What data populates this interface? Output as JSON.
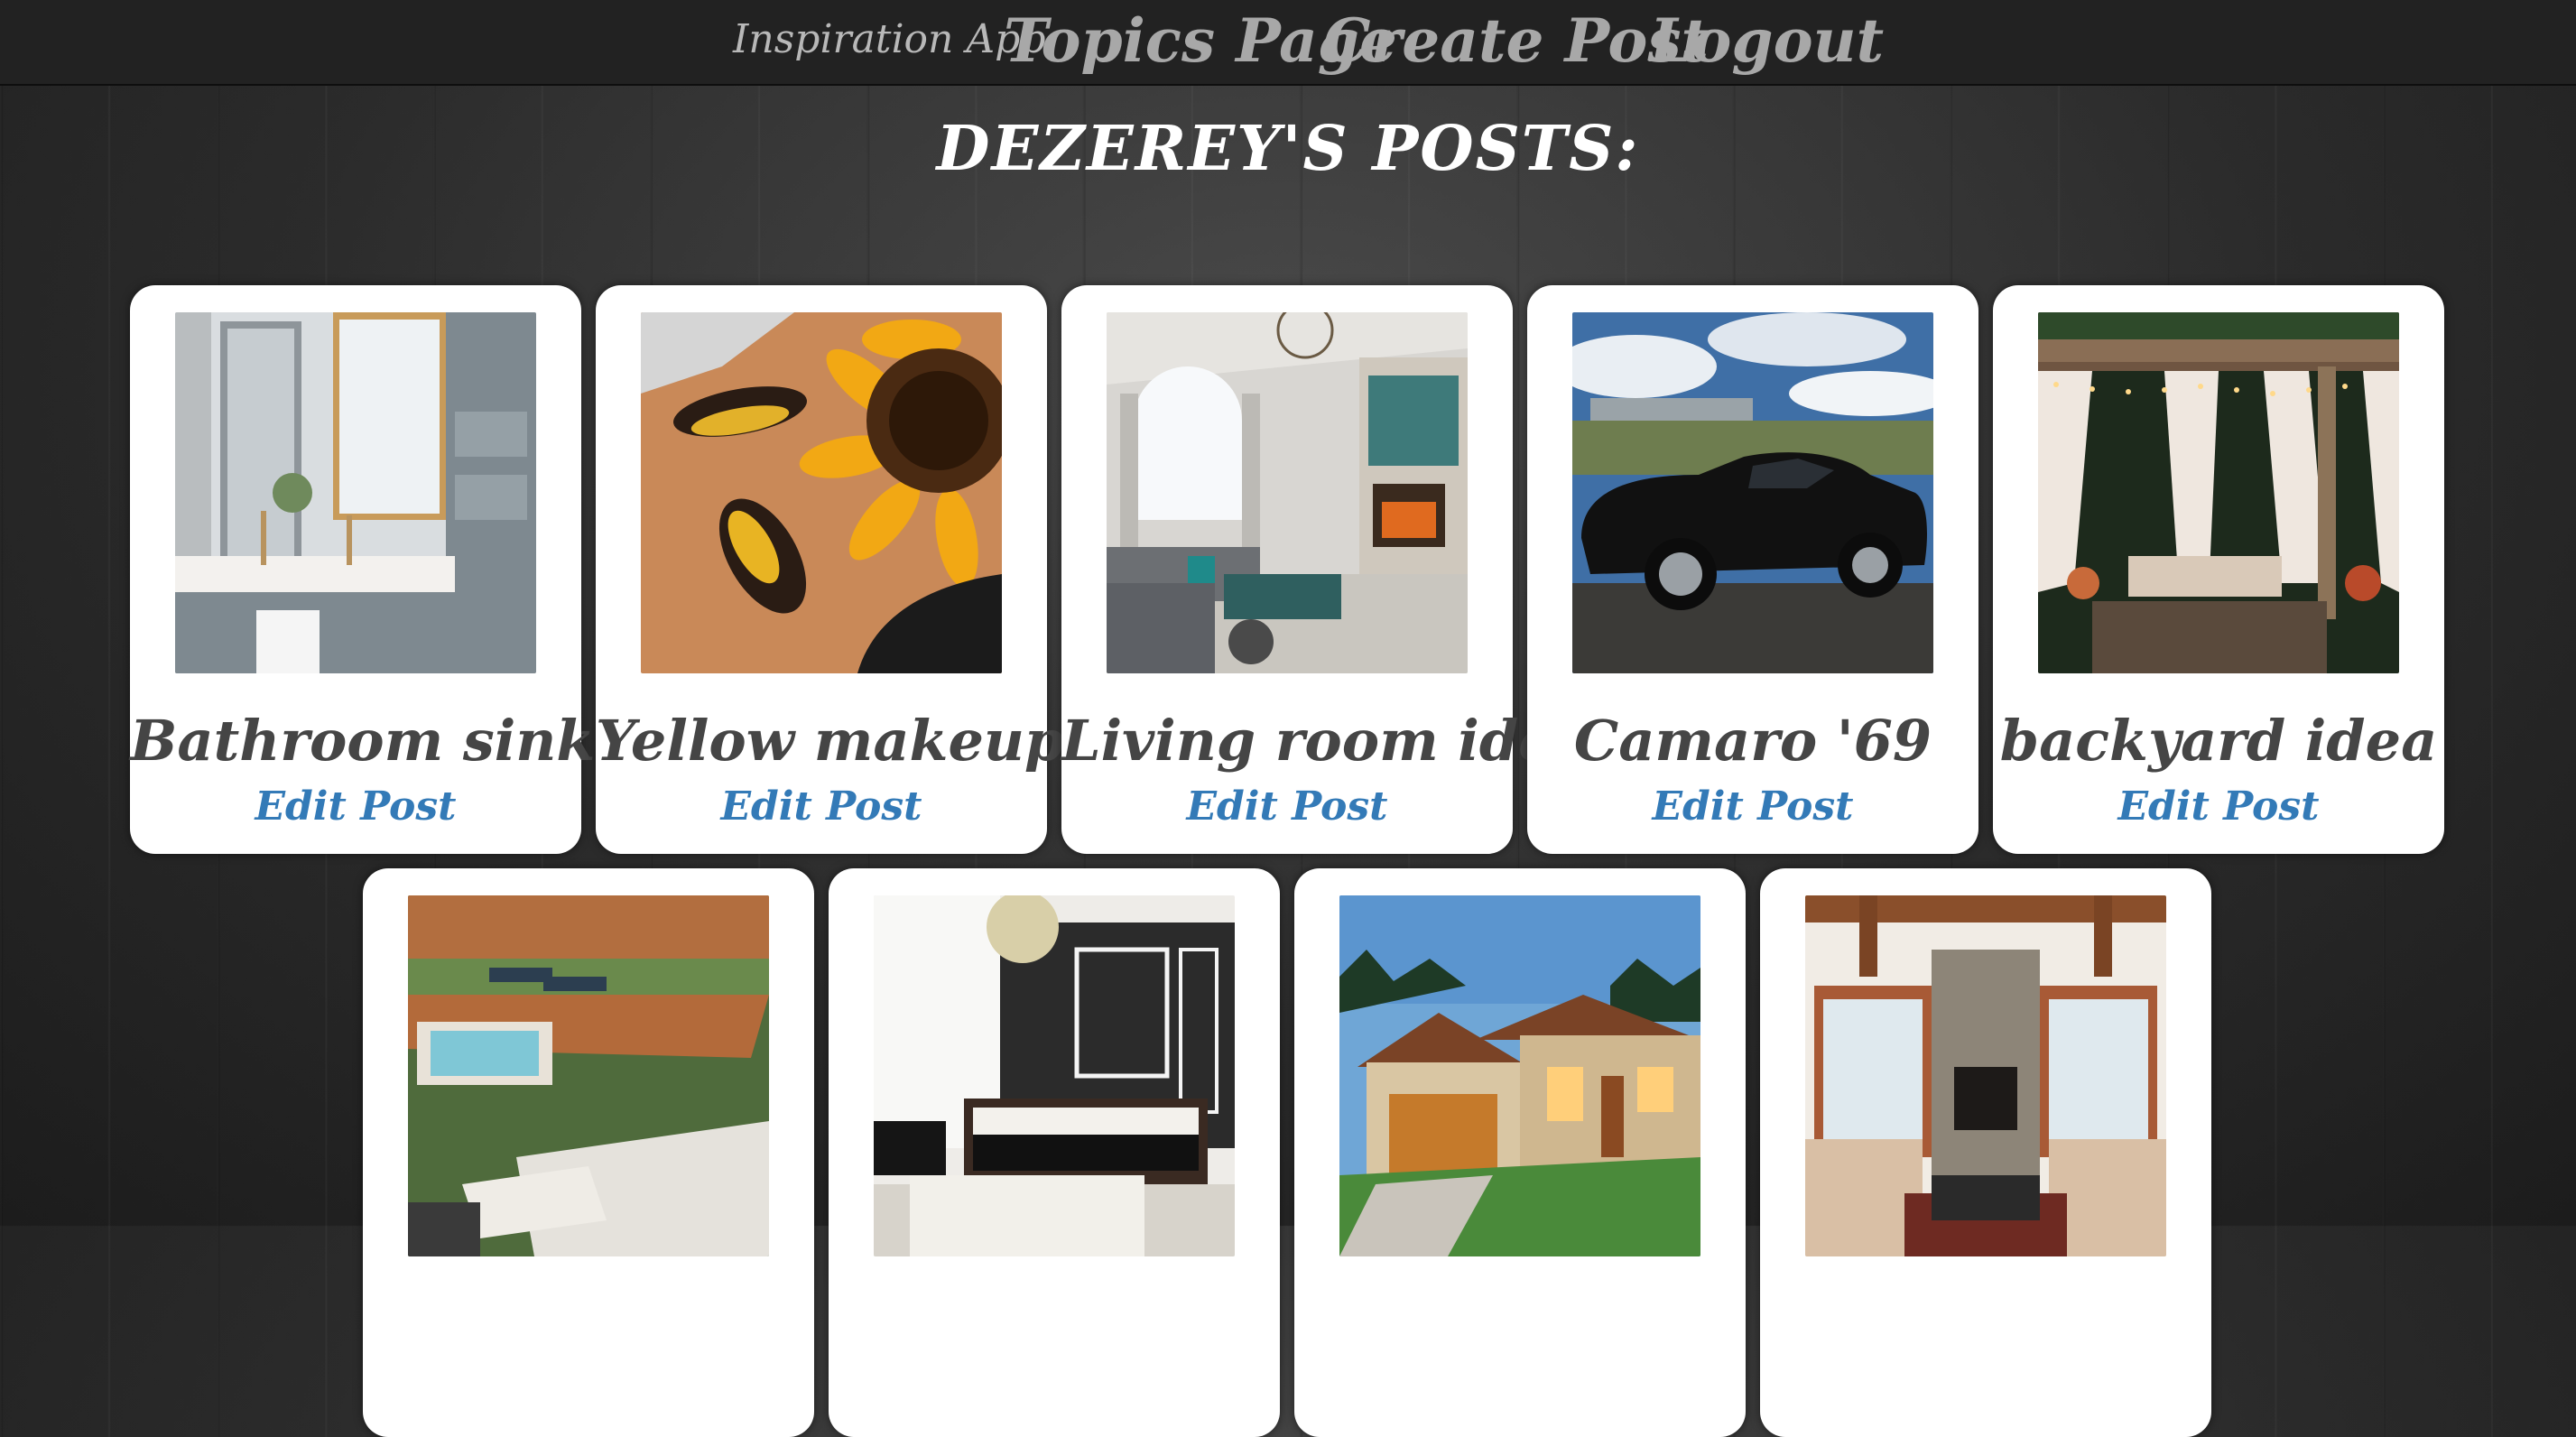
{
  "navbar": {
    "brand": "Inspiration App",
    "links": [
      "Topics Page",
      "Create Post",
      "Logout"
    ]
  },
  "heading": "DEZEREY'S POSTS:",
  "posts": [
    {
      "title": "Bathroom sink",
      "edit": "Edit Post",
      "image": "bathroom-sink-photo"
    },
    {
      "title": "Yellow makeup",
      "edit": "Edit Post",
      "image": "yellow-makeup-sunflower-photo"
    },
    {
      "title": "Living room idea",
      "edit": "Edit Post",
      "image": "living-room-fireplace-photo"
    },
    {
      "title": "Camaro '69",
      "edit": "Edit Post",
      "image": "black-camaro-car-photo"
    },
    {
      "title": "backyard idea",
      "edit": "Edit Post",
      "image": "backyard-pergola-photo"
    },
    {
      "title": "",
      "edit": "",
      "image": "patio-hot-tub-deck-photo"
    },
    {
      "title": "",
      "edit": "",
      "image": "bedroom-chandelier-photo"
    },
    {
      "title": "",
      "edit": "",
      "image": "house-exterior-photo"
    },
    {
      "title": "",
      "edit": "",
      "image": "living-room-stone-fireplace-photo"
    }
  ],
  "colors": {
    "navbar_bg": "#222222",
    "heading": "#ffffff",
    "title": "#454545",
    "link": "#337ab7"
  }
}
